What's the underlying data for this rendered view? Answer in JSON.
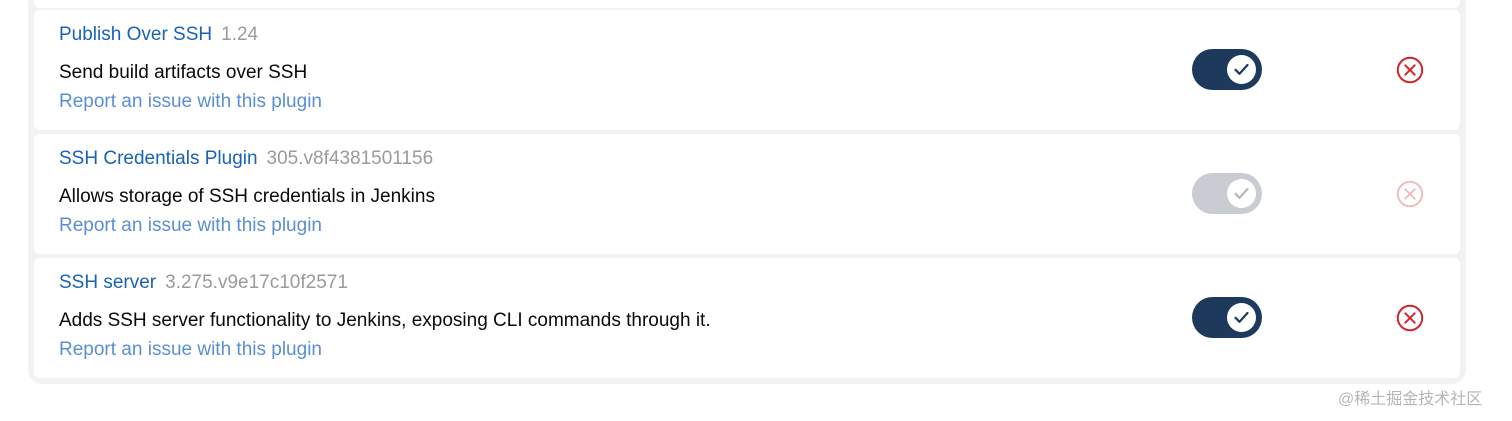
{
  "plugins": [
    {
      "name": "Publish Over SSH",
      "version": "1.24",
      "description": "Send build artifacts over SSH",
      "report_link": "Report an issue with this plugin",
      "enabled": true,
      "toggle_disabled": false,
      "uninstall_icon": "x-circle-icon"
    },
    {
      "name": "SSH Credentials Plugin",
      "version": "305.v8f4381501156",
      "description": "Allows storage of SSH credentials in Jenkins",
      "report_link": "Report an issue with this plugin",
      "enabled": true,
      "toggle_disabled": true,
      "uninstall_icon": "x-circle-icon"
    },
    {
      "name": "SSH server",
      "version": "3.275.v9e17c10f2571",
      "description": "Adds SSH server functionality to Jenkins, exposing CLI commands through it.",
      "report_link": "Report an issue with this plugin",
      "enabled": true,
      "toggle_disabled": false,
      "uninstall_icon": "x-circle-icon"
    }
  ],
  "watermark": "@稀土掘金技术社区",
  "colors": {
    "link": "#1a62b8",
    "report_link": "#5a8fd4",
    "toggle_on": "#1d3a5c",
    "toggle_disabled": "#c9ccd2",
    "uninstall": "#d2262c"
  }
}
